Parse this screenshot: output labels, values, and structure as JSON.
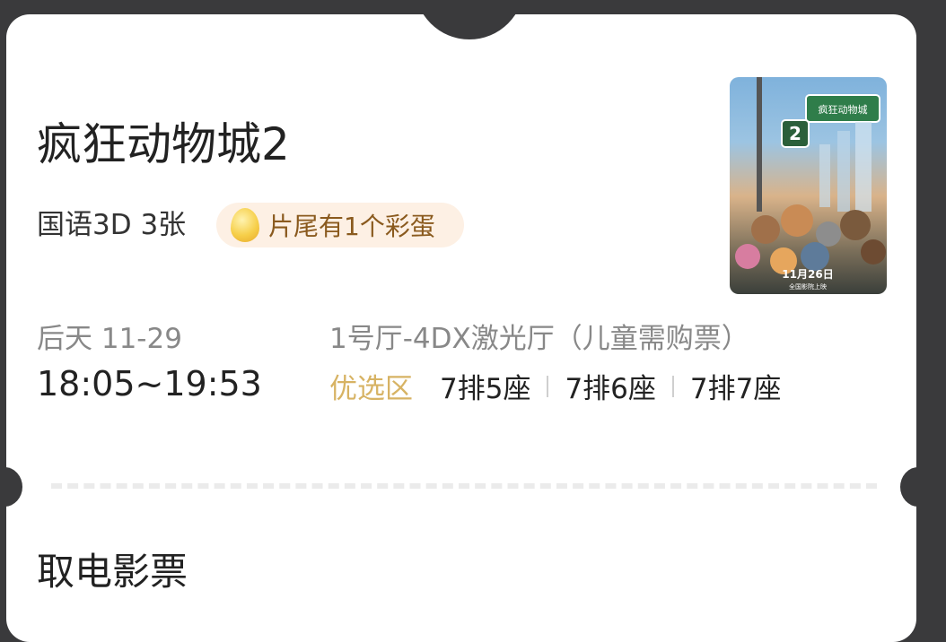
{
  "ticket": {
    "movie_title": "疯狂动物城2",
    "spec": "国语3D 3张",
    "egg_badge": "片尾有1个彩蛋",
    "date": "后天 11-29",
    "time": "18:05~19:53",
    "hall": "1号厅-4DX激光厅（儿童需购票）",
    "zone": "优选区",
    "seats": [
      "7排5座",
      "7排6座",
      "7排7座"
    ],
    "poster": {
      "title": "疯狂动物城",
      "number": "2",
      "date_text": "11月26日",
      "sub_text": "全国影院上映"
    }
  },
  "section": {
    "title": "取电影票"
  },
  "icons": {
    "egg": "egg-icon"
  },
  "colors": {
    "background": "#3a3a3c",
    "card": "#ffffff",
    "zone": "#d7b364",
    "badge_bg": "#fdf0e4",
    "badge_text": "#8a5a1e"
  }
}
